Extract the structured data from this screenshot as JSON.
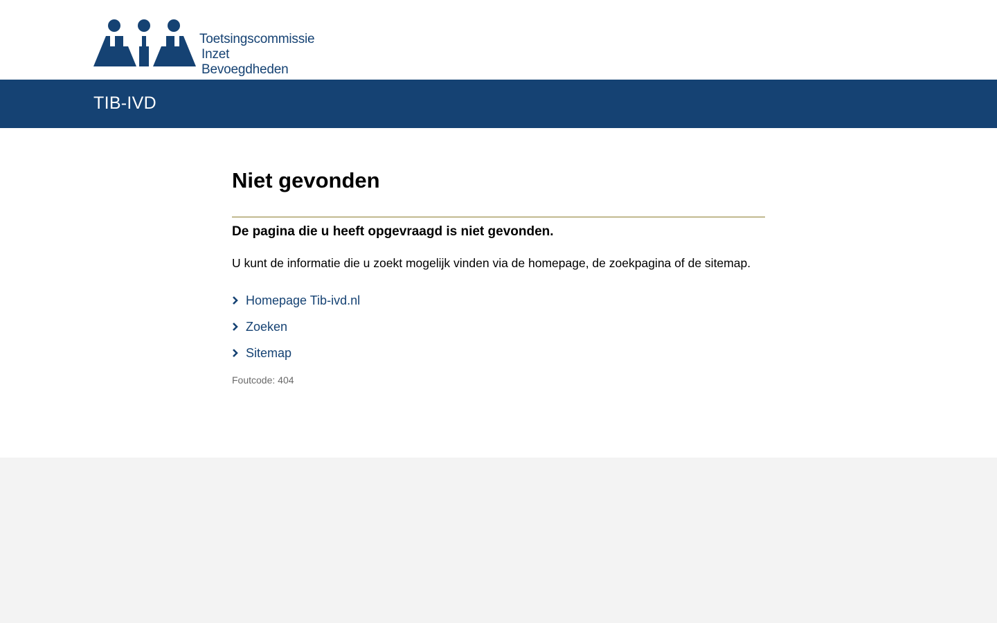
{
  "brand": {
    "logo_lines": [
      "Toetsingscommissie",
      "Inzet",
      "Bevoegdheden"
    ],
    "site_name": "TIB-IVD",
    "primary_color": "#154273",
    "divider_color": "#8b7a2c"
  },
  "main": {
    "title": "Niet gevonden",
    "subtitle": "De pagina die u heeft opgevraagd is niet gevonden.",
    "intro": "U kunt de informatie die u zoekt mogelijk vinden via de homepage, de zoekpagina of de sitemap.",
    "links": [
      {
        "label": "Homepage Tib-ivd.nl",
        "icon": "chevron-right-icon"
      },
      {
        "label": "Zoeken",
        "icon": "chevron-right-icon"
      },
      {
        "label": "Sitemap",
        "icon": "chevron-right-icon"
      }
    ],
    "error_code": "Foutcode: 404"
  }
}
